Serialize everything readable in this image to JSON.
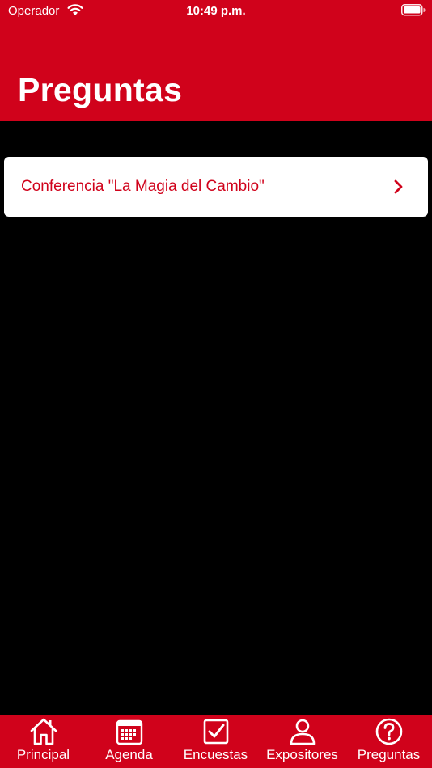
{
  "status_bar": {
    "carrier": "Operador",
    "time": "10:49 p.m."
  },
  "header": {
    "title": "Preguntas"
  },
  "list": {
    "items": [
      {
        "label": "Conferencia \"La Magia del Cambio\""
      }
    ]
  },
  "tab_bar": {
    "tabs": [
      {
        "label": "Principal",
        "icon": "house-icon"
      },
      {
        "label": "Agenda",
        "icon": "calendar-icon"
      },
      {
        "label": "Encuestas",
        "icon": "checkbox-icon"
      },
      {
        "label": "Expositores",
        "icon": "person-icon"
      },
      {
        "label": "Preguntas",
        "icon": "question-icon"
      }
    ]
  },
  "colors": {
    "brand": "#d0021b",
    "background": "#000000",
    "cell": "#ffffff"
  }
}
